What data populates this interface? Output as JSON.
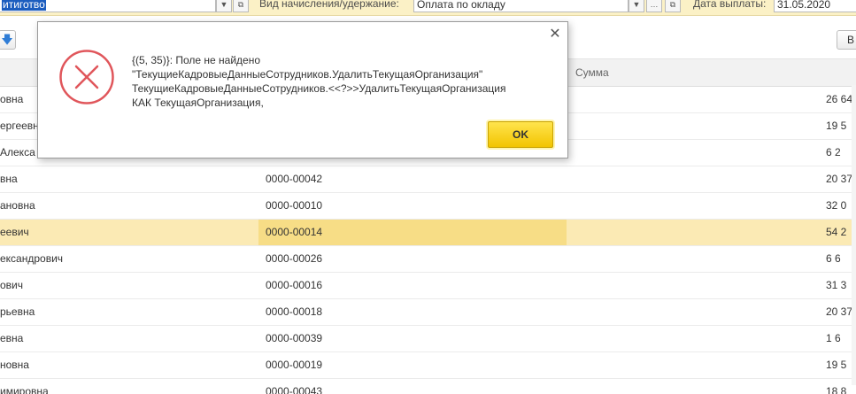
{
  "filter_bar": {
    "employee_field_value": "итиготво",
    "accrual_label": "Вид начисления/удержание:",
    "accrual_value": "Оплата по окладу",
    "date_label": "Дата выплаты:",
    "date_value": "31.05.2020"
  },
  "toolbar": {
    "right_button_label": "В"
  },
  "table": {
    "sum_header": "Сумма",
    "rows": [
      {
        "name": "овна",
        "number": "",
        "sum": "26 64"
      },
      {
        "name": "ергеевн",
        "number": "",
        "sum": "19 5"
      },
      {
        "name": "Алекса",
        "number": "",
        "sum": "6 2"
      },
      {
        "name": "вна",
        "number": "0000-00042",
        "sum": "20 37"
      },
      {
        "name": "ановна",
        "number": "0000-00010",
        "sum": "32 0"
      },
      {
        "name": "еевич",
        "number": "0000-00014",
        "sum": "54 2"
      },
      {
        "name": "ександрович",
        "number": "0000-00026",
        "sum": "6 6"
      },
      {
        "name": "ович",
        "number": "0000-00016",
        "sum": "31 3"
      },
      {
        "name": "рьевна",
        "number": "0000-00018",
        "sum": "20 37"
      },
      {
        "name": "евна",
        "number": "0000-00039",
        "sum": "1 6"
      },
      {
        "name": "новна",
        "number": "0000-00019",
        "sum": "19 5"
      },
      {
        "name": "имировна",
        "number": "0000-00043",
        "sum": "18 8"
      }
    ]
  },
  "dialog": {
    "message_lines": [
      "{(5, 35)}: Поле не найдено",
      "\"ТекущиеКадровыеДанныеСотрудников.УдалитьТекущаяОрганизация\"",
      "ТекущиеКадровыеДанныеСотрудников.<<?>>УдалитьТекущаяОрганизация",
      "КАК ТекущаяОрганизация,"
    ],
    "ok_label": "OK",
    "close_icon": "close-icon",
    "error_icon": "error-icon",
    "error_color": "#e0565b",
    "ok_color": "#f5cd0a"
  },
  "colors": {
    "selected_row": "#fbeab4",
    "selected_cell": "#f7dd86",
    "filter_bar": "#fbf1c6"
  }
}
